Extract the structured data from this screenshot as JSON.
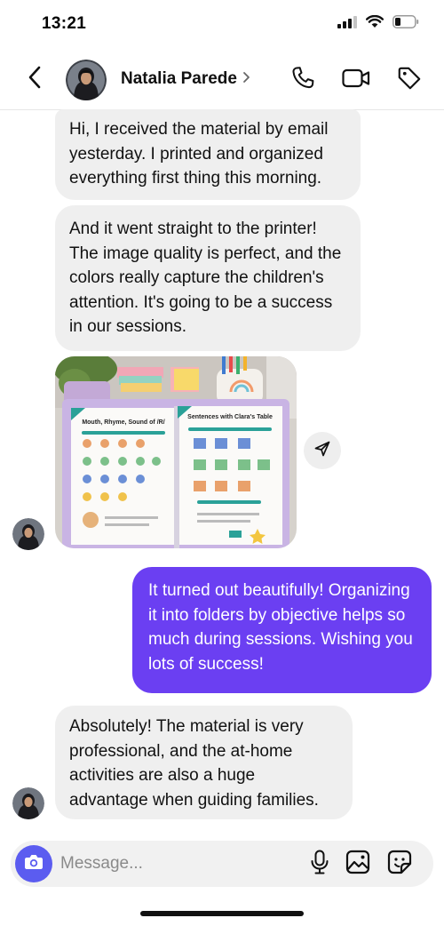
{
  "status_bar": {
    "time": "13:21",
    "icons": [
      "signal-icon",
      "wifi-icon",
      "battery-icon"
    ]
  },
  "header": {
    "contact_name": "Natalia Parede",
    "icons": [
      "back-chevron-icon",
      "chevron-right-icon",
      "phone-icon",
      "video-icon",
      "tag-icon"
    ]
  },
  "messages": [
    {
      "direction": "in",
      "text": "Hi, I received the material by email yesterday. I printed and organized everything first thing this morning."
    },
    {
      "direction": "in",
      "text": "And it went straight to the printer! The image quality is perfect, and the colors really capture the children's attention. It's going to be a success in our sessions."
    },
    {
      "direction": "in",
      "type": "image",
      "image": {
        "left_page_title": "Mouth, Rhyme, Sound of /R/",
        "right_page_title": "Sentences with Clara's Table"
      }
    },
    {
      "direction": "out",
      "text": "It turned out beautifully! Organizing it into folders by objective helps so much during sessions. Wishing you lots of success!"
    },
    {
      "direction": "in",
      "text": "Absolutely! The material is very professional, and the at-home activities are also a huge advantage when guiding families."
    }
  ],
  "composer": {
    "placeholder": "Message...",
    "icons": [
      "camera-icon",
      "microphone-icon",
      "gallery-icon",
      "sticker-icon"
    ]
  },
  "colors": {
    "outgoing_bubble": "#6b3ff2",
    "incoming_bubble": "#efefef",
    "camera_button": "#5b5cf0"
  }
}
